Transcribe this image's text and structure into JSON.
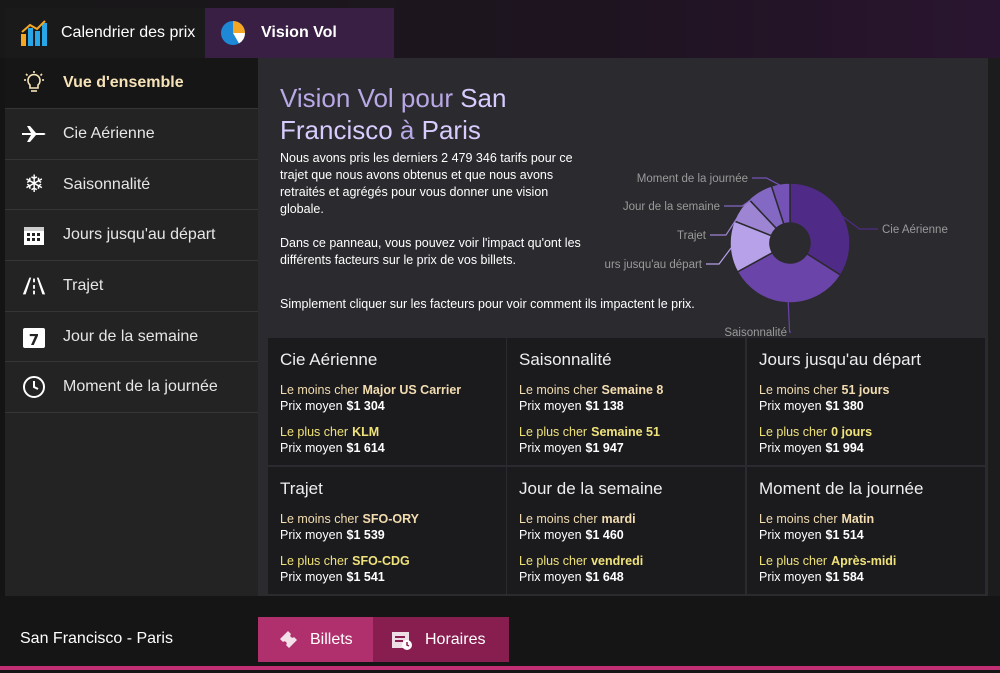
{
  "top_tabs": [
    {
      "label": "Calendrier des prix"
    },
    {
      "label": "Vision Vol"
    }
  ],
  "sidebar": {
    "items": [
      {
        "label": "Vue d'ensemble"
      },
      {
        "label": "Cie Aérienne"
      },
      {
        "label": "Saisonnalité"
      },
      {
        "label": "Jours jusqu'au départ"
      },
      {
        "label": "Trajet"
      },
      {
        "label": "Jour de la semaine"
      },
      {
        "label": "Moment de la journée"
      }
    ]
  },
  "main": {
    "title_prefix": "Vision Vol pour ",
    "title_origin": "San Francisco",
    "title_mid": " à ",
    "title_dest": "Paris",
    "intro_1": "Nous avons pris les derniers 2 479 346 tarifs pour ce trajet que nous avons obtenus et que nous avons retraités et agrégés pour vous donner une vision globale.",
    "intro_2": "Dans ce panneau, vous pouvez voir l'impact qu'ont les différents facteurs sur le prix de vos billets.",
    "intro_3": "Simplement cliquer sur les facteurs pour voir comment ils impactent le prix."
  },
  "chart_data": {
    "type": "pie",
    "title": "",
    "series": [
      {
        "categories": [
          "Cie Aérienne",
          "Saisonnalité",
          "Jours jusqu'au départ",
          "Trajet",
          "Jour de la semaine",
          "Moment de la journée"
        ],
        "values": [
          34,
          33,
          14,
          7,
          7,
          5
        ]
      }
    ],
    "labels": [
      "Cie Aérienne",
      "Saisonnalité",
      "urs jusqu'au départ",
      "Trajet",
      "Jour de la semaine",
      "Moment de la journée"
    ],
    "colors": [
      "#4f2a86",
      "#6a44a8",
      "#b7a1e8",
      "#9d85d4",
      "#8368c4",
      "#7553b6"
    ]
  },
  "cards": [
    {
      "title": "Cie Aérienne",
      "cheap_label": "Le moins cher",
      "cheap_value": "Major US Carrier",
      "avg_label": "Prix moyen",
      "cheap_avg": "$1 304",
      "exp_label": "Le plus cher",
      "exp_value": "KLM",
      "exp_avg": "$1 614"
    },
    {
      "title": "Saisonnalité",
      "cheap_label": "Le moins cher",
      "cheap_value": "Semaine 8",
      "avg_label": "Prix moyen",
      "cheap_avg": "$1 138",
      "exp_label": "Le plus cher",
      "exp_value": "Semaine 51",
      "exp_avg": "$1 947"
    },
    {
      "title": "Jours jusqu'au départ",
      "cheap_label": "Le moins cher",
      "cheap_value": "51 jours",
      "avg_label": "Prix moyen",
      "cheap_avg": "$1 380",
      "exp_label": "Le plus cher",
      "exp_value": "0 jours",
      "exp_avg": "$1 994"
    },
    {
      "title": "Trajet",
      "cheap_label": "Le moins cher",
      "cheap_value": "SFO-ORY",
      "avg_label": "Prix moyen",
      "cheap_avg": "$1 539",
      "exp_label": "Le plus cher",
      "exp_value": "SFO-CDG",
      "exp_avg": "$1 541"
    },
    {
      "title": "Jour de la semaine",
      "cheap_label": "Le moins cher",
      "cheap_value": "mardi",
      "avg_label": "Prix moyen",
      "cheap_avg": "$1 460",
      "exp_label": "Le plus cher",
      "exp_value": "vendredi",
      "exp_avg": "$1 648"
    },
    {
      "title": "Moment de la journée",
      "cheap_label": "Le moins cher",
      "cheap_value": "Matin",
      "avg_label": "Prix moyen",
      "cheap_avg": "$1 514",
      "exp_label": "Le plus cher",
      "exp_value": "Après-midi",
      "exp_avg": "$1 584"
    }
  ],
  "bottom": {
    "route": "San Francisco - Paris",
    "tabs": [
      {
        "label": "Billets"
      },
      {
        "label": "Horaires"
      }
    ]
  }
}
